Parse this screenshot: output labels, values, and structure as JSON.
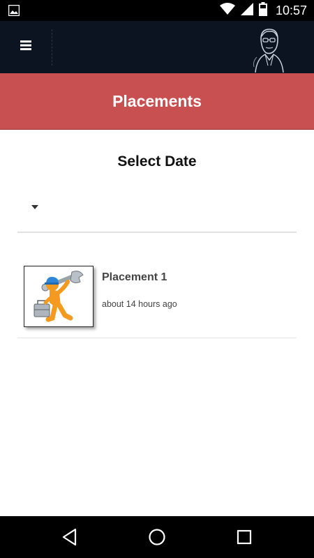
{
  "status_bar": {
    "time": "10:57",
    "icons": [
      "image-notification-icon",
      "wifi-icon",
      "cellular-signal-icon",
      "battery-icon"
    ]
  },
  "app_bar": {
    "menu_icon": "hamburger-menu-icon",
    "avatar": "portrait-logo"
  },
  "page": {
    "title": "Placements"
  },
  "date_picker": {
    "heading": "Select Date",
    "selected": ""
  },
  "list": {
    "items": [
      {
        "title": "Placement 1",
        "time": "about 14 hours ago",
        "thumbnail": "worker-with-wrench-image"
      }
    ]
  },
  "nav_bar": {
    "icons": [
      "back-icon",
      "home-icon",
      "recents-icon"
    ]
  },
  "colors": {
    "app_bar": "#0b1420",
    "banner": "#c95050",
    "status_bar": "#000000"
  }
}
